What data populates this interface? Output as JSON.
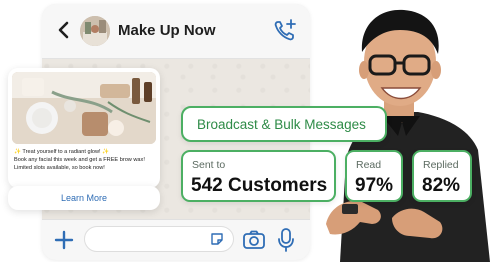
{
  "chat": {
    "title": "Make Up Now",
    "message": {
      "line1": "✨ Treat yourself to a radiant glow! ✨",
      "line2": "Book any facial this week and get a FREE brow wax!",
      "line3": "Limited slots available, so book now!"
    },
    "learn_more_label": "Learn More"
  },
  "stats": {
    "broadcast_label": "Broadcast & Bulk Messages",
    "sent_label": "Sent to",
    "sent_value": "542 Customers",
    "read_label": "Read",
    "read_value": "97%",
    "replied_label": "Replied",
    "replied_value": "82%"
  },
  "icons": {
    "back": "chevron-left-icon",
    "call": "add-call-icon",
    "plus": "plus-icon",
    "sticker": "sticker-icon",
    "camera": "camera-icon",
    "mic": "microphone-icon"
  },
  "colors": {
    "accent_green": "#4caf63",
    "accent_green_text": "#2e8b47",
    "link_blue": "#2f6db5",
    "icon_blue": "#2f6db5"
  }
}
